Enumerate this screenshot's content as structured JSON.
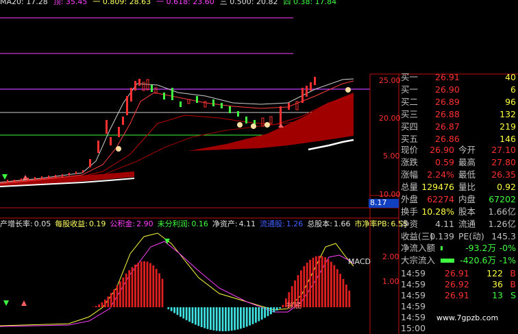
{
  "top_ma": [
    {
      "label": "MA20: 17.28",
      "color": "#e0e0e0"
    },
    {
      "label": "顶: 35.45",
      "color": "#ff40ff"
    },
    {
      "label": "一 0.809: 28.63",
      "color": "#ffff60"
    },
    {
      "label": "一 0.618: 23.60",
      "color": "#ff40ff"
    },
    {
      "label": "三 0.500: 20.82",
      "color": "#e0e0e0"
    },
    {
      "label": "四 0.38: 17.84",
      "color": "#40ff40"
    }
  ],
  "price_axis": [
    "25.00",
    "20.00",
    "5.00",
    "10.00"
  ],
  "price_highlight": "8.17",
  "indicator_axis": [
    "2.00",
    "1.00"
  ],
  "macd_label": "MACD",
  "chao_di_label": "抄底",
  "info_bar": [
    {
      "label": "产增长率:",
      "value": "0.05",
      "lc": "#e0e0e0",
      "vc": "#e0e0e0"
    },
    {
      "label": "每股收益:",
      "value": "0.19",
      "lc": "#ffff60",
      "vc": "#ffff60"
    },
    {
      "label": "公积金:",
      "value": "2.90",
      "lc": "#ff40ff",
      "vc": "#ff40ff"
    },
    {
      "label": "未分利润:",
      "value": "0.16",
      "lc": "#40ff40",
      "vc": "#40ff40"
    },
    {
      "label": "净资产:",
      "value": "4.11",
      "lc": "#e0e0e0",
      "vc": "#e0e0e0"
    },
    {
      "label": "流通股:",
      "value": "1.26",
      "lc": "#4060ff",
      "vc": "#4060ff"
    },
    {
      "label": "总股本:",
      "value": "1.66",
      "lc": "#e0e0e0",
      "vc": "#e0e0e0"
    },
    {
      "label": "市净率PB:",
      "value": "6.55",
      "lc": "#ffff60",
      "vc": "#ffff60"
    }
  ],
  "orderbook": {
    "sells": [
      {
        "label": "买一",
        "price": "26.91",
        "vol": "40"
      },
      {
        "label": "买一",
        "price": "26.90",
        "vol": "6"
      },
      {
        "label": "买二",
        "price": "26.89",
        "vol": "96"
      },
      {
        "label": "买三",
        "price": "26.88",
        "vol": "132"
      },
      {
        "label": "买四",
        "price": "26.87",
        "vol": "219"
      },
      {
        "label": "买五",
        "price": "26.86",
        "vol": "146"
      }
    ]
  },
  "quote": {
    "xianjia_label": "现价",
    "xianjia": "26.90",
    "jinkai_label": "今开",
    "jinkai": "27.10",
    "zhangdie_label": "涨跌",
    "zhangdie": "0.59",
    "zuigao_label": "最高",
    "zuigao": "27.80",
    "zhangfu_label": "涨幅",
    "zhangfu": "2.24%",
    "zuidi_label": "最低",
    "zuidi": "26.35",
    "zongliang_label": "总量",
    "zongliang": "129476",
    "liangbi_label": "量比",
    "liangbi": "0.92",
    "waipan_label": "外盘",
    "waipan": "62274",
    "neipan_label": "内盘",
    "neipan": "67202",
    "huanshou_label": "换手",
    "huanshou": "10.28%",
    "guben_label": "股本",
    "guben": "1.66亿",
    "jingzi_label": "净资",
    "jingzi": "4.11",
    "liutong_label": "流通",
    "liutong": "1.26亿",
    "shouyi_label": "收益(三)",
    "shouyi": "0.139",
    "pe_label": "PE(动)",
    "pe": "145.3"
  },
  "flows": [
    {
      "label": "净流入额",
      "value": "-93.2万",
      "pct": "-0%",
      "bar": 0.05
    },
    {
      "label": "大宗流入",
      "value": "-420.6万",
      "pct": "-1%",
      "bar": 0.5
    }
  ],
  "ticks": [
    {
      "time": "14:59",
      "price": "26.91",
      "vol": "122",
      "side": "B"
    },
    {
      "time": "14:59",
      "price": "26.92",
      "vol": "36",
      "side": "B"
    },
    {
      "time": "14:59",
      "price": "26.91",
      "vol": "13",
      "side": "S"
    },
    {
      "time": "14:59",
      "price": "",
      "vol": "",
      "side": ""
    },
    {
      "time": "14:59",
      "price": "",
      "vol": "",
      "side": ""
    },
    {
      "time": "15:00",
      "price": "",
      "vol": "",
      "side": ""
    }
  ],
  "watermark": "www.7gpzb.com",
  "colors": {
    "up": "#ff3030",
    "down": "#40e0e0",
    "green": "#40ff40",
    "yellow": "#ffff40",
    "magenta": "#ff40ff"
  }
}
